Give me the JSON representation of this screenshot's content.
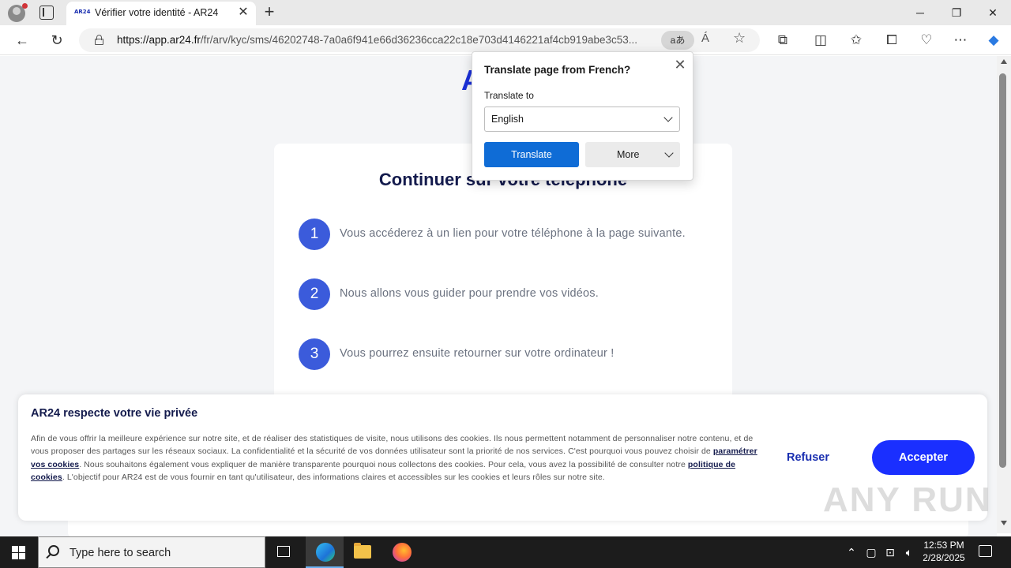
{
  "browser": {
    "tab_title": "Vérifier votre identité - AR24",
    "tab_favicon_text": "AR24",
    "url_host": "https://app.ar24.fr",
    "url_path": "/fr/arv/kyc/sms/46202748-7a0a6f941e66d36236cca22c18e703d4146221af4cb919abe3c53...",
    "translate_glyph": "aあ",
    "readaloud_glyph": "Á"
  },
  "page": {
    "logo_text": "A",
    "card_title": "Continuer sur votre téléphone",
    "steps": [
      {
        "num": "1",
        "text": "Vous accéderez à un lien pour votre téléphone à la page suivante."
      },
      {
        "num": "2",
        "text": "Nous allons vous guider pour prendre vos vidéos."
      },
      {
        "num": "3",
        "text": "Vous pourrez ensuite retourner sur votre ordinateur !"
      }
    ]
  },
  "cookie": {
    "title": "AR24 respecte votre vie privée",
    "text_1": "Afin de vous offrir la meilleure expérience sur notre site, et de réaliser des statistiques de visite, nous utilisons des cookies. Ils nous permettent notamment de personnaliser notre contenu, et de vous proposer des partages sur les réseaux sociaux. La confidentialité et la sécurité de vos données utilisateur sont la priorité de nos services. C'est pourquoi vous pouvez choisir de ",
    "link_1": "paramétrer vos cookies",
    "text_2": ". Nous souhaitons également vous expliquer de manière transparente pourquoi nous collectons des cookies. Pour cela, vous avez la possibilité de consulter notre ",
    "link_2": "politique de cookies",
    "text_3": ". L'objectif pour AR24 est de vous fournir en tant qu'utilisateur, des informations claires et accessibles sur les cookies et leurs rôles sur notre site.",
    "refuse_label": "Refuser",
    "accept_label": "Accepter"
  },
  "translate_popup": {
    "title": "Translate page from French?",
    "label": "Translate to",
    "selected_language": "English",
    "translate_label": "Translate",
    "more_label": "More"
  },
  "watermark": "ANY RUN",
  "taskbar": {
    "search_placeholder": "Type here to search",
    "time": "12:53 PM",
    "date": "2/28/2025"
  },
  "colors": {
    "brand_blue": "#1a2fff",
    "step_blue": "#3b5bdb",
    "translate_button": "#0f6cd6"
  }
}
